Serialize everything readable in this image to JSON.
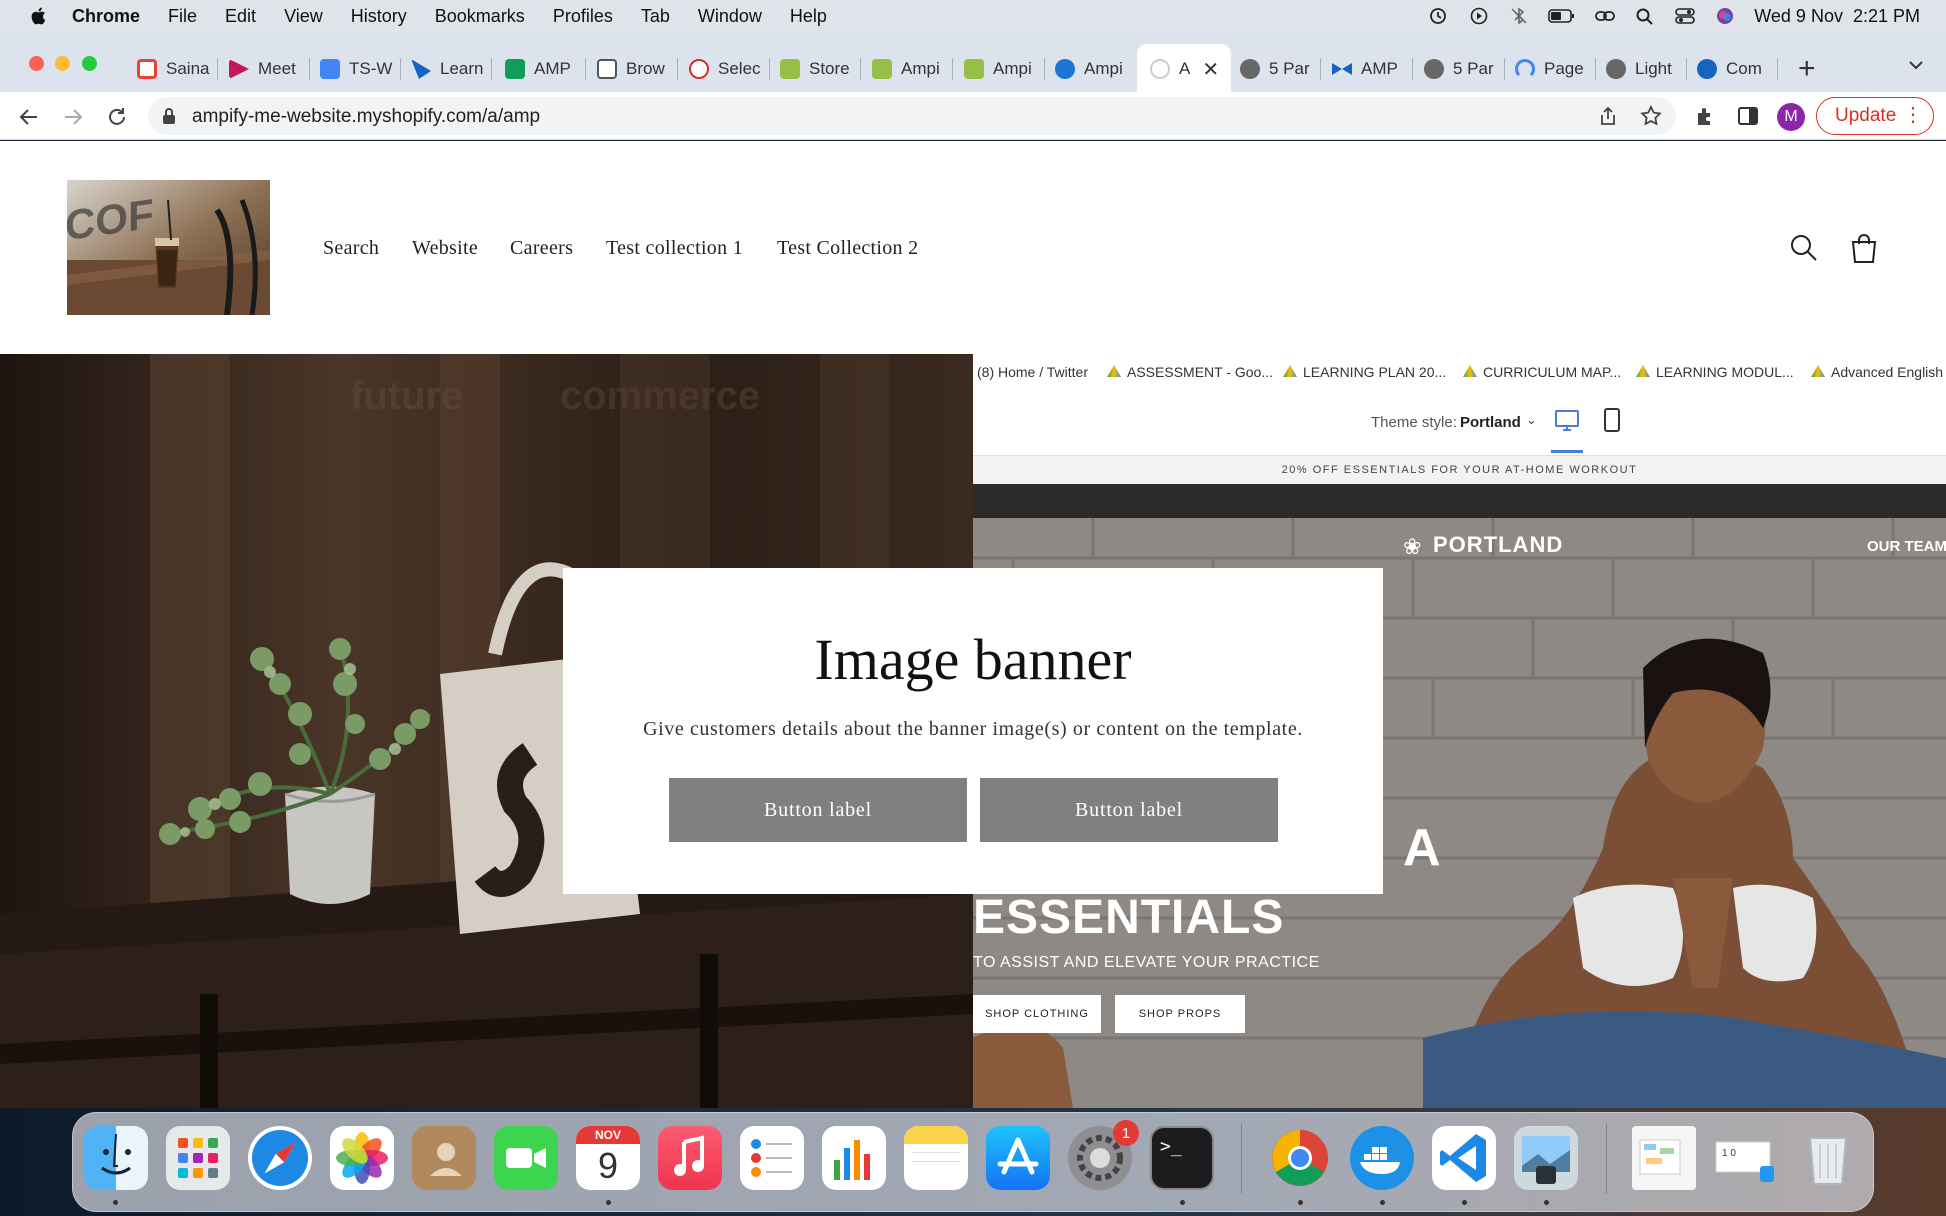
{
  "menubar": {
    "app": "Chrome",
    "items": [
      "File",
      "Edit",
      "View",
      "History",
      "Bookmarks",
      "Profiles",
      "Tab",
      "Window",
      "Help"
    ],
    "clock": "Wed 9 Nov  2:21 PM"
  },
  "tabs": [
    {
      "label": "Saina",
      "icon": "gmail-icon",
      "color": "#ea4335"
    },
    {
      "label": "Meet",
      "icon": "meet-icon",
      "color": "#c2185b"
    },
    {
      "label": "TS-W",
      "icon": "docs-icon",
      "color": "#4285f4"
    },
    {
      "label": "Learn",
      "icon": "learn-icon",
      "color": "#1565c0"
    },
    {
      "label": "AMP",
      "icon": "sheets-icon",
      "color": "#0f9d58"
    },
    {
      "label": "Brow",
      "icon": "page-icon",
      "color": "#555555"
    },
    {
      "label": "Selec",
      "icon": "select-icon",
      "color": "#d32f2f"
    },
    {
      "label": "Store",
      "icon": "shopify-icon",
      "color": "#95bf47"
    },
    {
      "label": "Ampi",
      "icon": "shopify-icon",
      "color": "#95bf47"
    },
    {
      "label": "Ampi",
      "icon": "shopify-icon",
      "color": "#95bf47"
    },
    {
      "label": "Ampi",
      "icon": "ampify-icon",
      "color": "#1976d2"
    },
    {
      "label": "A",
      "icon": "loading-icon",
      "color": "#bbbbbb"
    },
    {
      "label": "5 Par",
      "icon": "globe-icon",
      "color": "#666666"
    },
    {
      "label": "AMP",
      "icon": "confluence-icon",
      "color": "#1565c0"
    },
    {
      "label": "5 Par",
      "icon": "globe-icon",
      "color": "#666666"
    },
    {
      "label": "Page",
      "icon": "pagespeed-icon",
      "color": "#4285f4"
    },
    {
      "label": "Light",
      "icon": "globe-icon",
      "color": "#666666"
    },
    {
      "label": "Com",
      "icon": "bolt-icon",
      "color": "#1565c0"
    }
  ],
  "toolbar": {
    "url": "ampify-me-website.myshopify.com/a/amp",
    "update_label": "Update",
    "avatar_letter": "M"
  },
  "store": {
    "nav": [
      "Search",
      "Website",
      "Careers",
      "Test collection 1",
      "Test Collection 2"
    ]
  },
  "embedded": {
    "bookmarks": [
      "(8) Home / Twitter",
      "ASSESSMENT - Goo...",
      "LEARNING PLAN 20...",
      "CURRICULUM MAP...",
      "LEARNING MODUL...",
      "Advanced English"
    ],
    "theme_label": "Theme style:",
    "theme_value": "Portland",
    "promo": "20% OFF ESSENTIALS FOR YOUR AT-HOME WORKOUT",
    "brand": "PORTLAND",
    "our_team": "OUR TEAM",
    "hero_letter": "A",
    "hero_title": "ESSENTIALS",
    "hero_sub": "TO ASSIST AND ELEVATE YOUR PRACTICE",
    "btn_clothing": "SHOP CLOTHING",
    "btn_props": "SHOP PROPS"
  },
  "banner": {
    "heading": "Image banner",
    "text": "Give customers details about the banner image(s) or content on the template.",
    "button1": "Button label",
    "button2": "Button label"
  },
  "dock": {
    "apps": [
      "finder-icon",
      "launchpad-icon",
      "safari-icon",
      "photos-icon",
      "contacts-icon",
      "facetime-icon",
      "calendar-icon",
      "music-icon",
      "reminders-icon",
      "numbers-icon",
      "notes-icon",
      "app-store-icon",
      "system-preferences-icon",
      "terminal-icon",
      "chrome-icon",
      "docker-icon",
      "vscode-icon",
      "preview-icon",
      "document-icon",
      "screenshot-icon",
      "trash-icon"
    ],
    "calendar_month": "NOV",
    "calendar_day": "9",
    "badge": "1"
  }
}
